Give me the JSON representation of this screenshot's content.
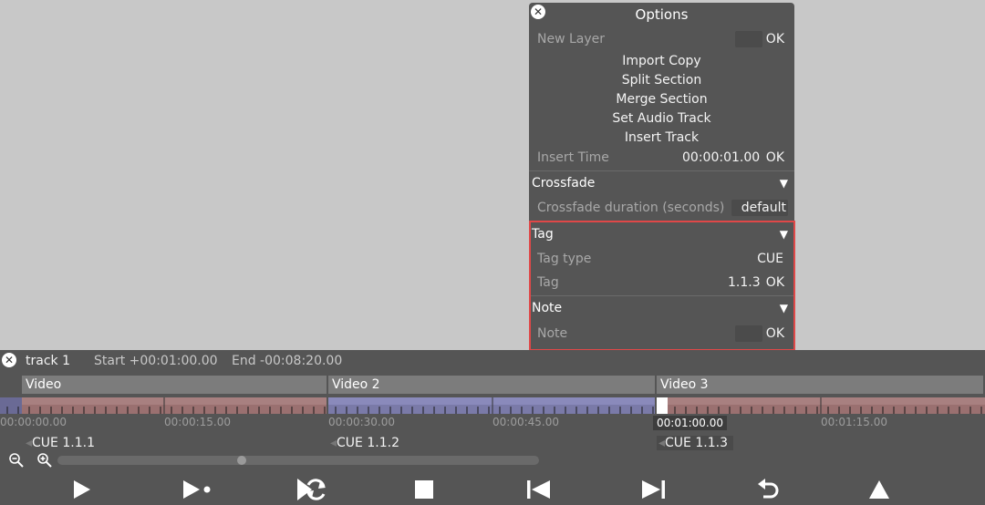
{
  "options": {
    "title": "Options",
    "new_layer_label": "New Layer",
    "new_layer_ok": "OK",
    "menu": [
      "Import Copy",
      "Split Section",
      "Merge Section",
      "Set Audio Track",
      "Insert Track"
    ],
    "insert_time_label": "Insert Time",
    "insert_time_value": "00:00:01.00",
    "insert_time_ok": "OK",
    "crossfade": {
      "header": "Crossfade",
      "duration_label": "Crossfade duration (seconds)",
      "duration_value": "default"
    },
    "tag": {
      "header": "Tag",
      "type_label": "Tag type",
      "type_value": "CUE",
      "tag_label": "Tag",
      "tag_value": "1.1.3",
      "tag_ok": "OK"
    },
    "note": {
      "header": "Note",
      "note_label": "Note",
      "note_ok": "OK"
    }
  },
  "track": {
    "name": "track 1",
    "start": "Start +00:01:00.00",
    "end": "End -00:08:20.00",
    "clips": [
      "Video",
      "Video 2",
      "Video 3"
    ],
    "times": [
      "00:00:00.00",
      "00:00:15.00",
      "00:00:30.00",
      "00:00:45.00",
      "00:01:00.00",
      "00:01:15.00"
    ],
    "cues": [
      "CUE 1.1.1",
      "CUE 1.1.2",
      "CUE 1.1.3"
    ],
    "zoom_scroll_position": 0.38
  },
  "icons": {
    "close": "close-icon",
    "zoom_out": "zoom-out-icon",
    "zoom_in": "zoom-in-icon",
    "play": "play-icon",
    "play_next": "play-to-next-icon",
    "loop": "loop-icon",
    "stop": "stop-icon",
    "skip_back": "skip-back-icon",
    "skip_forward": "skip-forward-icon",
    "undo": "undo-icon",
    "eject": "eject-icon"
  },
  "colors": {
    "highlight": "#e04848",
    "panel": "#555555",
    "clip_red": "#a07878",
    "clip_blue": "#8585b5"
  }
}
